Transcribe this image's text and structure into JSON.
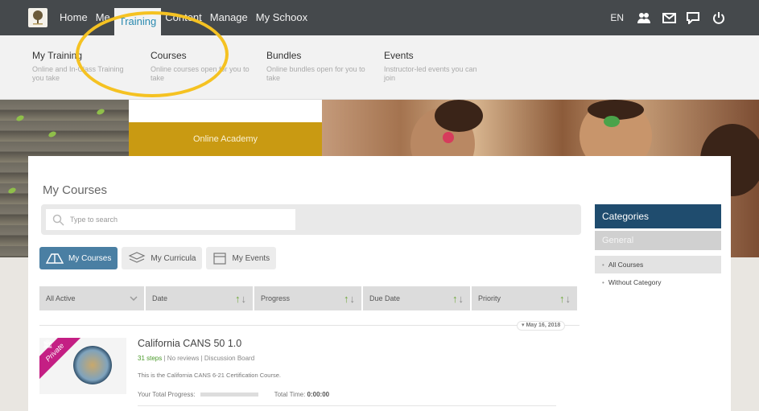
{
  "nav": {
    "items": [
      "Home",
      "Me",
      "Training",
      "Content",
      "Manage",
      "My Schoox"
    ],
    "active_index": 2,
    "lang": "EN"
  },
  "icons": [
    "people-icon",
    "mail-icon",
    "chat-icon",
    "power-icon"
  ],
  "dropdown": {
    "items": [
      {
        "title": "My Training",
        "desc": "Online and In-Class Training you take"
      },
      {
        "title": "Courses",
        "desc": "Online courses open for you to take"
      },
      {
        "title": "Bundles",
        "desc": "Online bundles open for you to take"
      },
      {
        "title": "Events",
        "desc": "Instructor-led events you can join"
      }
    ]
  },
  "banner": {
    "academy_label": "Online Academy"
  },
  "main": {
    "title": "My Courses",
    "search_placeholder": "Type to search",
    "tabs": [
      {
        "label": "My Courses",
        "icon": "courses-icon"
      },
      {
        "label": "My Curricula",
        "icon": "curricula-icon"
      },
      {
        "label": "My Events",
        "icon": "calendar-icon"
      }
    ],
    "active_tab": 0,
    "filters": [
      "All Active",
      "Date",
      "Progress",
      "Due Date",
      "Priority"
    ],
    "date_tag": "May 16, 2018",
    "course": {
      "badge": "Private",
      "title": "California CANS 50 1.0",
      "steps": "31 steps",
      "reviews": "No reviews",
      "board": "Discussion Board",
      "desc": "This is the California CANS 6-21 Certification Course.",
      "progress_label": "Your Total Progress:",
      "progress_value": 0,
      "time_label": "Total Time:",
      "time_value": "0:00:00"
    }
  },
  "categories": {
    "header": "Categories",
    "general": "General",
    "items": [
      "All Courses",
      "Without Category"
    ],
    "active_index": 0
  },
  "colors": {
    "topbar": "#45494c",
    "active_nav_text": "#2a8ab0",
    "highlight": "#f5c222",
    "academy": "#c99a12",
    "tab_active": "#4a7fa3",
    "category_header": "#1f4c6e",
    "private_badge": "#c41f84",
    "steps_green": "#4a9a2a"
  }
}
